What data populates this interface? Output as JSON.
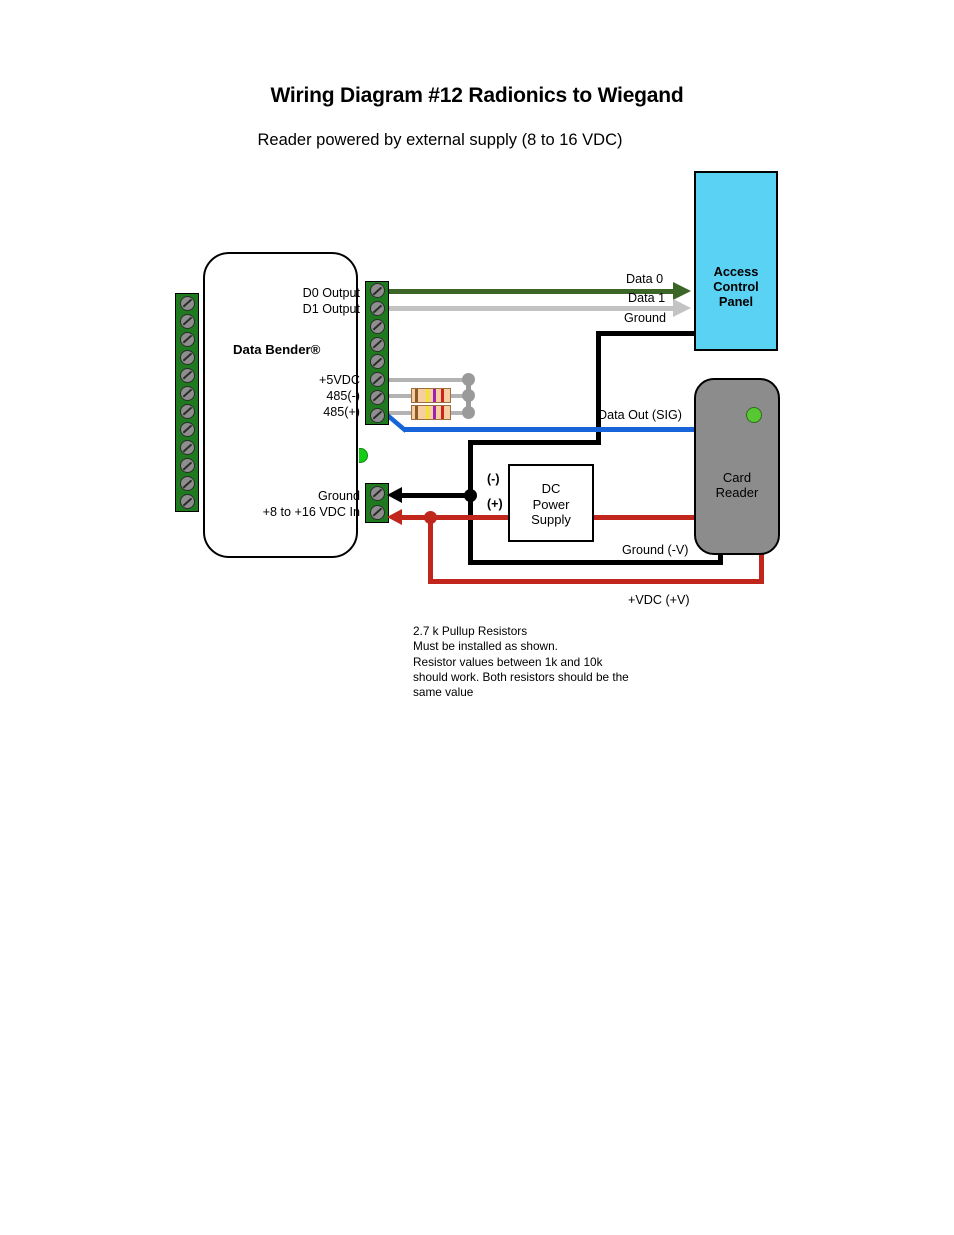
{
  "document": {
    "title": "Wiring Diagram  #12 Radionics to Wiegand",
    "subtitle": "Reader powered by external supply (8 to 16 VDC)"
  },
  "device": {
    "name": "Data Bender®",
    "left_terminal_count": 12,
    "right_top_terminal_count": 8,
    "right_bottom_terminal_count": 2,
    "terminals": {
      "d0_output": "D0 Output",
      "d1_output": "D1 Output",
      "vdc5": "+5VDC",
      "rs485_neg": "485(-)",
      "rs485_pos": "485(+)",
      "ground_in": "Ground",
      "power_in": "+8 to +16 VDC In"
    },
    "led_color": "#16cc16"
  },
  "access_control_panel": {
    "label_line1": "Access",
    "label_line2": "Control",
    "label_line3": "Panel",
    "color": "#5ad2f4"
  },
  "card_reader": {
    "label_line1": "Card",
    "label_line2": "Reader",
    "color": "#8c8c8c",
    "led_color": "#57c832"
  },
  "power_supply": {
    "label_line1": "DC",
    "label_line2": "Power",
    "label_line3": "Supply",
    "negative_terminal": "(-)",
    "positive_terminal": "(+)"
  },
  "wire_labels": {
    "data0": "Data 0",
    "data1": "Data 1",
    "ground_panel": "Ground",
    "data_out": "Data Out (SIG)",
    "ground_v": "Ground (-V)",
    "vdc_v": "+VDC (+V)"
  },
  "wire_colors": {
    "data0": "#3c6627",
    "data1": "#c3c3c3",
    "ground": "#000000",
    "power_positive": "#c0261b",
    "data_out": "#1664d8",
    "pullup": "#b3b3b3"
  },
  "note": {
    "line1": "2.7 k Pullup Resistors",
    "line2": "Must be installed as shown.",
    "line3": "Resistor values between 1k and 10k",
    "line4": "should work.  Both resistors should be the",
    "line5": "same value"
  },
  "resistors": {
    "count": 2,
    "value": "2.7 k",
    "band_colors": [
      "#8a5a2b",
      "#f2e42a",
      "#a020b0",
      "#d02020"
    ]
  }
}
